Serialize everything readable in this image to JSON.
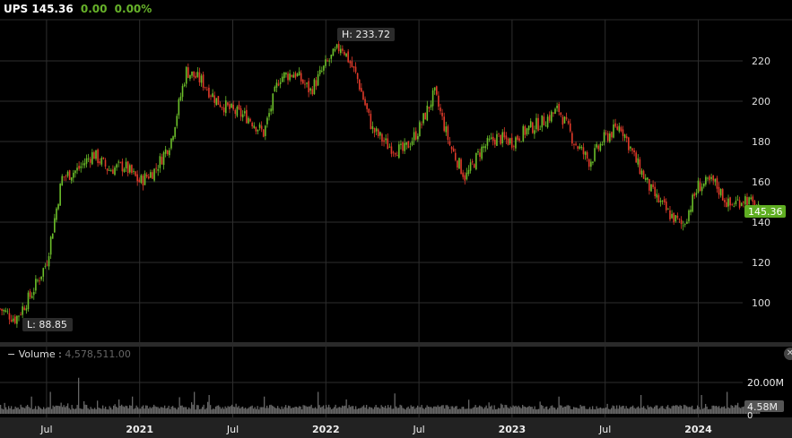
{
  "header": {
    "symbol": "UPS",
    "price": "145.36",
    "change": "0.00",
    "change_pct": "0.00%"
  },
  "volume_pane": {
    "dash": "−",
    "label": "Volume",
    "sep": ":",
    "value": "4,578,511.00",
    "close_icon": "close-icon"
  },
  "colors": {
    "up": "#6cbf2a",
    "down": "#e03a2a",
    "grid": "#2e2e2e",
    "tag": "#5fae22",
    "volume": "#666666",
    "axis_bg": "#222222"
  },
  "chart_data": {
    "type": "candlestick",
    "title": "UPS",
    "ylim": [
      80,
      240
    ],
    "y_ticks": [
      "100",
      "120",
      "140",
      "160",
      "180",
      "200",
      "220"
    ],
    "x_ticks": [
      {
        "label": "Jul",
        "month_index": 3,
        "bold": false
      },
      {
        "label": "2021",
        "month_index": 9,
        "bold": true
      },
      {
        "label": "Jul",
        "month_index": 15,
        "bold": false
      },
      {
        "label": "2022",
        "month_index": 21,
        "bold": true
      },
      {
        "label": "Jul",
        "month_index": 27,
        "bold": false
      },
      {
        "label": "2023",
        "month_index": 33,
        "bold": true
      },
      {
        "label": "Jul",
        "month_index": 39,
        "bold": false
      },
      {
        "label": "2024",
        "month_index": 45,
        "bold": true
      }
    ],
    "start_month": "2020-04",
    "monthly_close_approx": [
      97,
      92,
      104,
      120,
      162,
      166,
      174,
      166,
      168,
      160,
      166,
      180,
      215,
      210,
      200,
      195,
      192,
      184,
      212,
      214,
      205,
      218,
      228,
      212,
      186,
      178,
      175,
      186,
      204,
      178,
      162,
      176,
      182,
      180,
      186,
      190,
      196,
      180,
      170,
      182,
      188,
      170,
      155,
      145,
      138,
      158,
      160,
      148,
      152,
      145
    ],
    "high_label": "H: 233.72",
    "low_label": "L: 88.85",
    "last_price_tag": "145.36",
    "volume": {
      "ylim": [
        0,
        24
      ],
      "unit": "M",
      "tick_label": "20.00M",
      "zero_label": "0",
      "last_tag": "4.58M",
      "typical": 4.5,
      "spikes": [
        [
          5.0,
          23
        ],
        [
          3.2,
          14
        ],
        [
          12.5,
          14
        ],
        [
          13.4,
          12
        ],
        [
          20.5,
          14
        ],
        [
          25.4,
          13
        ],
        [
          30.2,
          9
        ],
        [
          36.0,
          11
        ],
        [
          41.3,
          12
        ],
        [
          45.2,
          12
        ],
        [
          46.8,
          14
        ],
        [
          2.0,
          11
        ],
        [
          8.5,
          11
        ],
        [
          17.0,
          11
        ]
      ]
    }
  }
}
